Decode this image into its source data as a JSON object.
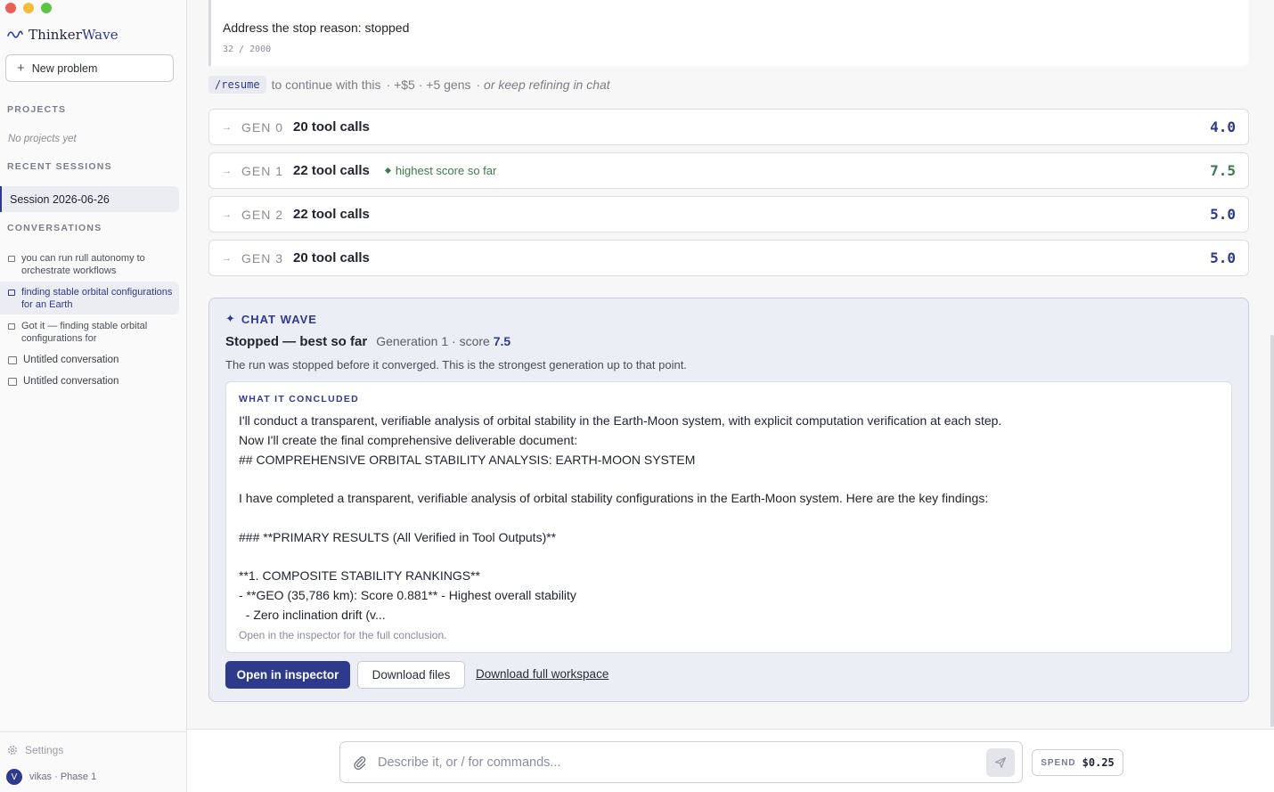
{
  "app": {
    "brand_prefix": "Thinker",
    "brand_suffix": "Wave",
    "accent_color": "#2e3a8c",
    "success_color": "#3d7a4a"
  },
  "sidebar": {
    "new_problem_label": "New problem",
    "projects_heading": "PROJECTS",
    "projects_empty": "No projects yet",
    "recent_sessions_heading": "RECENT SESSIONS",
    "sessions": [
      {
        "label": "Session 2026-06-26"
      }
    ],
    "conversations_heading": "CONVERSATIONS",
    "conversations": [
      {
        "label": "you can run rull autonomy to orchestrate workflows"
      },
      {
        "label": "finding stable orbital configurations for an Earth"
      },
      {
        "label": "Got it — finding stable orbital configurations for"
      },
      {
        "label": "Untitled conversation"
      },
      {
        "label": "Untitled conversation"
      }
    ],
    "settings_label": "Settings",
    "user_initial": "V",
    "user_label": "vikas · Phase 1"
  },
  "prompt_card": {
    "text": "Address the stop reason: stopped",
    "char_count": "32 / 2000"
  },
  "resume": {
    "command": "/resume",
    "text": "to continue with this",
    "cost": "· +$5 · +5 gens",
    "alt": "· or keep refining in chat"
  },
  "generations": [
    {
      "label": "GEN 0",
      "calls": "20 tool calls",
      "badge": "",
      "score": "4.0"
    },
    {
      "label": "GEN 1",
      "calls": "22 tool calls",
      "badge": "highest score so far",
      "score": "7.5"
    },
    {
      "label": "GEN 2",
      "calls": "22 tool calls",
      "badge": "",
      "score": "5.0"
    },
    {
      "label": "GEN 3",
      "calls": "20 tool calls",
      "badge": "",
      "score": "5.0"
    }
  ],
  "chat_wave": {
    "heading": "CHAT WAVE",
    "status": "Stopped — best so far",
    "generation_text": "Generation 1 · score",
    "score": "7.5",
    "description": "The run was stopped before it converged. This is the strongest generation up to that point.",
    "conclusion_heading": "WHAT IT CONCLUDED",
    "conclusion_text": "I'll conduct a transparent, verifiable analysis of orbital stability in the Earth-Moon system, with explicit computation verification at each step.\nNow I'll create the final comprehensive deliverable document:\n## COMPREHENSIVE ORBITAL STABILITY ANALYSIS: EARTH-MOON SYSTEM\n\nI have completed a transparent, verifiable analysis of orbital stability configurations in the Earth-Moon system. Here are the key findings:\n\n### **PRIMARY RESULTS (All Verified in Tool Outputs)**\n\n**1. COMPOSITE STABILITY RANKINGS**\n- **GEO (35,786 km): Score 0.881** - Highest overall stability\n  - Zero inclination drift (v...",
    "conclusion_footer": "Open in the inspector for the full conclusion.",
    "open_inspector_label": "Open in inspector",
    "download_files_label": "Download files",
    "download_workspace_label": "Download full workspace"
  },
  "composer": {
    "placeholder": "Describe it, or / for commands...",
    "value": ""
  },
  "spend": {
    "label": "SPEND",
    "value": "$0.25"
  }
}
